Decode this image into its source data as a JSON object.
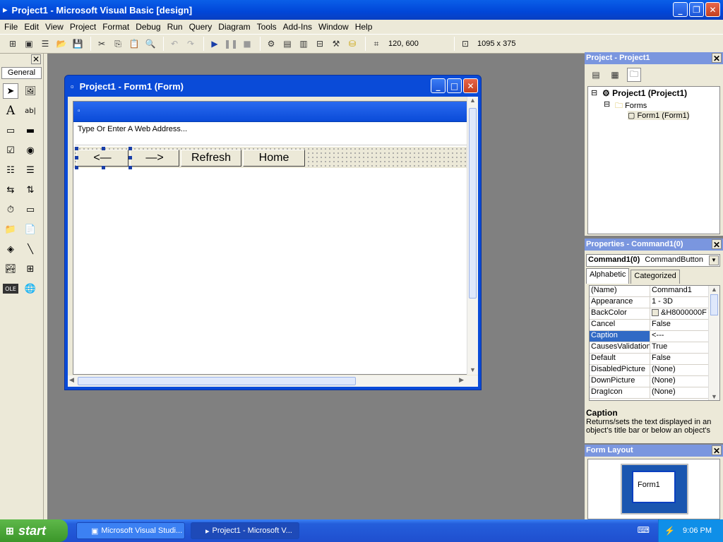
{
  "window": {
    "title": "Project1 - Microsoft Visual Basic [design]"
  },
  "menu": [
    "File",
    "Edit",
    "View",
    "Project",
    "Format",
    "Debug",
    "Run",
    "Query",
    "Diagram",
    "Tools",
    "Add-Ins",
    "Window",
    "Help"
  ],
  "toolbar": {
    "position": "120, 600",
    "size": "1095 x 375"
  },
  "toolbox": {
    "tab": "General"
  },
  "form_window": {
    "title": "Project1 - Form1 (Form)",
    "address_text": "Type Or Enter A Web Address...",
    "buttons": [
      "<—",
      "—>",
      "Refresh",
      "Home"
    ]
  },
  "project_panel": {
    "title": "Project - Project1",
    "tree": {
      "root": "Project1 (Project1)",
      "folder": "Forms",
      "item": "Form1 (Form1)"
    }
  },
  "properties_panel": {
    "title": "Properties - Command1(0)",
    "object": "Command1(0)",
    "object_type": "CommandButton",
    "tabs": [
      "Alphabetic",
      "Categorized"
    ],
    "rows": [
      {
        "name": "(Name)",
        "value": "Command1"
      },
      {
        "name": "Appearance",
        "value": "1 - 3D"
      },
      {
        "name": "BackColor",
        "value": "&H8000000F"
      },
      {
        "name": "Cancel",
        "value": "False"
      },
      {
        "name": "Caption",
        "value": "<---"
      },
      {
        "name": "CausesValidation",
        "value": "True"
      },
      {
        "name": "Default",
        "value": "False"
      },
      {
        "name": "DisabledPicture",
        "value": "(None)"
      },
      {
        "name": "DownPicture",
        "value": "(None)"
      },
      {
        "name": "DragIcon",
        "value": "(None)"
      }
    ],
    "selected_row": "Caption",
    "desc_title": "Caption",
    "desc_text": "Returns/sets the text displayed in an object's title bar or below an object's"
  },
  "layout_panel": {
    "title": "Form Layout",
    "form": "Form1"
  },
  "taskbar": {
    "start": "start",
    "tasks": [
      "Microsoft Visual Studi...",
      "Project1 - Microsoft V..."
    ],
    "clock": "9:06 PM"
  },
  "colors": {
    "titlebar": "#0a4bd8",
    "selection": "#316ac5",
    "desktop": "#808080"
  }
}
